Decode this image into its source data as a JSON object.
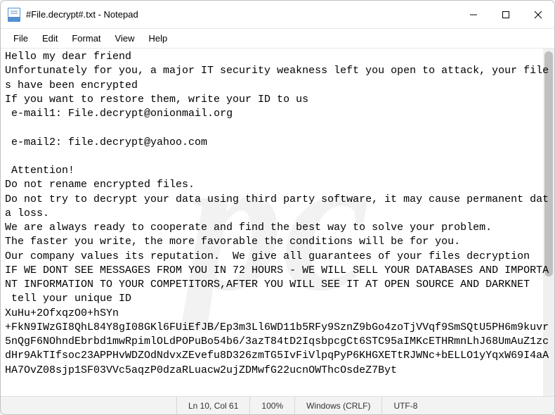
{
  "window": {
    "title": "#File.decrypt#.txt - Notepad"
  },
  "menu": {
    "items": [
      "File",
      "Edit",
      "Format",
      "View",
      "Help"
    ]
  },
  "content": {
    "text": "Hello my dear friend\nUnfortunately for you, a major IT security weakness left you open to attack, your files have been encrypted\nIf you want to restore them, write your ID to us\n e-mail1: File.decrypt@onionmail.org\n\n e-mail2: file.decrypt@yahoo.com\n\n Attention!\nDo not rename encrypted files.\nDo not try to decrypt your data using third party software, it may cause permanent data loss.\nWe are always ready to cooperate and find the best way to solve your problem.\nThe faster you write, the more favorable the conditions will be for you.\nOur company values its reputation.  We give all guarantees of your files decryption\nIF WE DONT SEE MESSAGES FROM YOU IN 72 HOURS - WE WILL SELL YOUR DATABASES AND IMPORTANT INFORMATION TO YOUR COMPETITORS,AFTER YOU WILL SEE IT AT OPEN SOURCE AND DARKNET\n tell your unique ID\nXuHu+2OfxqzO0+hSYn\n+FkN9IWzGI8QhL84Y8gI08GKl6FUiEfJB/Ep3m3Ll6WD11b5RFy9SznZ9bGo4zoTjVVqf9SmSQtU5PH6m9kuvr5nQgF6NOhndEbrbd1mwRpimlOLdPOPuBo54b6/3azT84tD2IqsbpcgCt6STC95aIMKcETHRmnLhJ68UmAuZ1zcdHr9AkTIfsoc23APPHvWDZOdNdvxZEvefu8D326zmTG5IvFiVlpqPyP6KHGXETtRJWNc+bELLO1yYqxW69I4aAHA7OvZ08sjp1SF03VVc5aqzP0dzaRLuacw2ujZDMwfG22ucnOWThcOsdeZ7Byt"
  },
  "status": {
    "position": "Ln 10, Col 61",
    "zoom": "100%",
    "line_ending": "Windows (CRLF)",
    "encoding": "UTF-8"
  },
  "watermark": "pc"
}
